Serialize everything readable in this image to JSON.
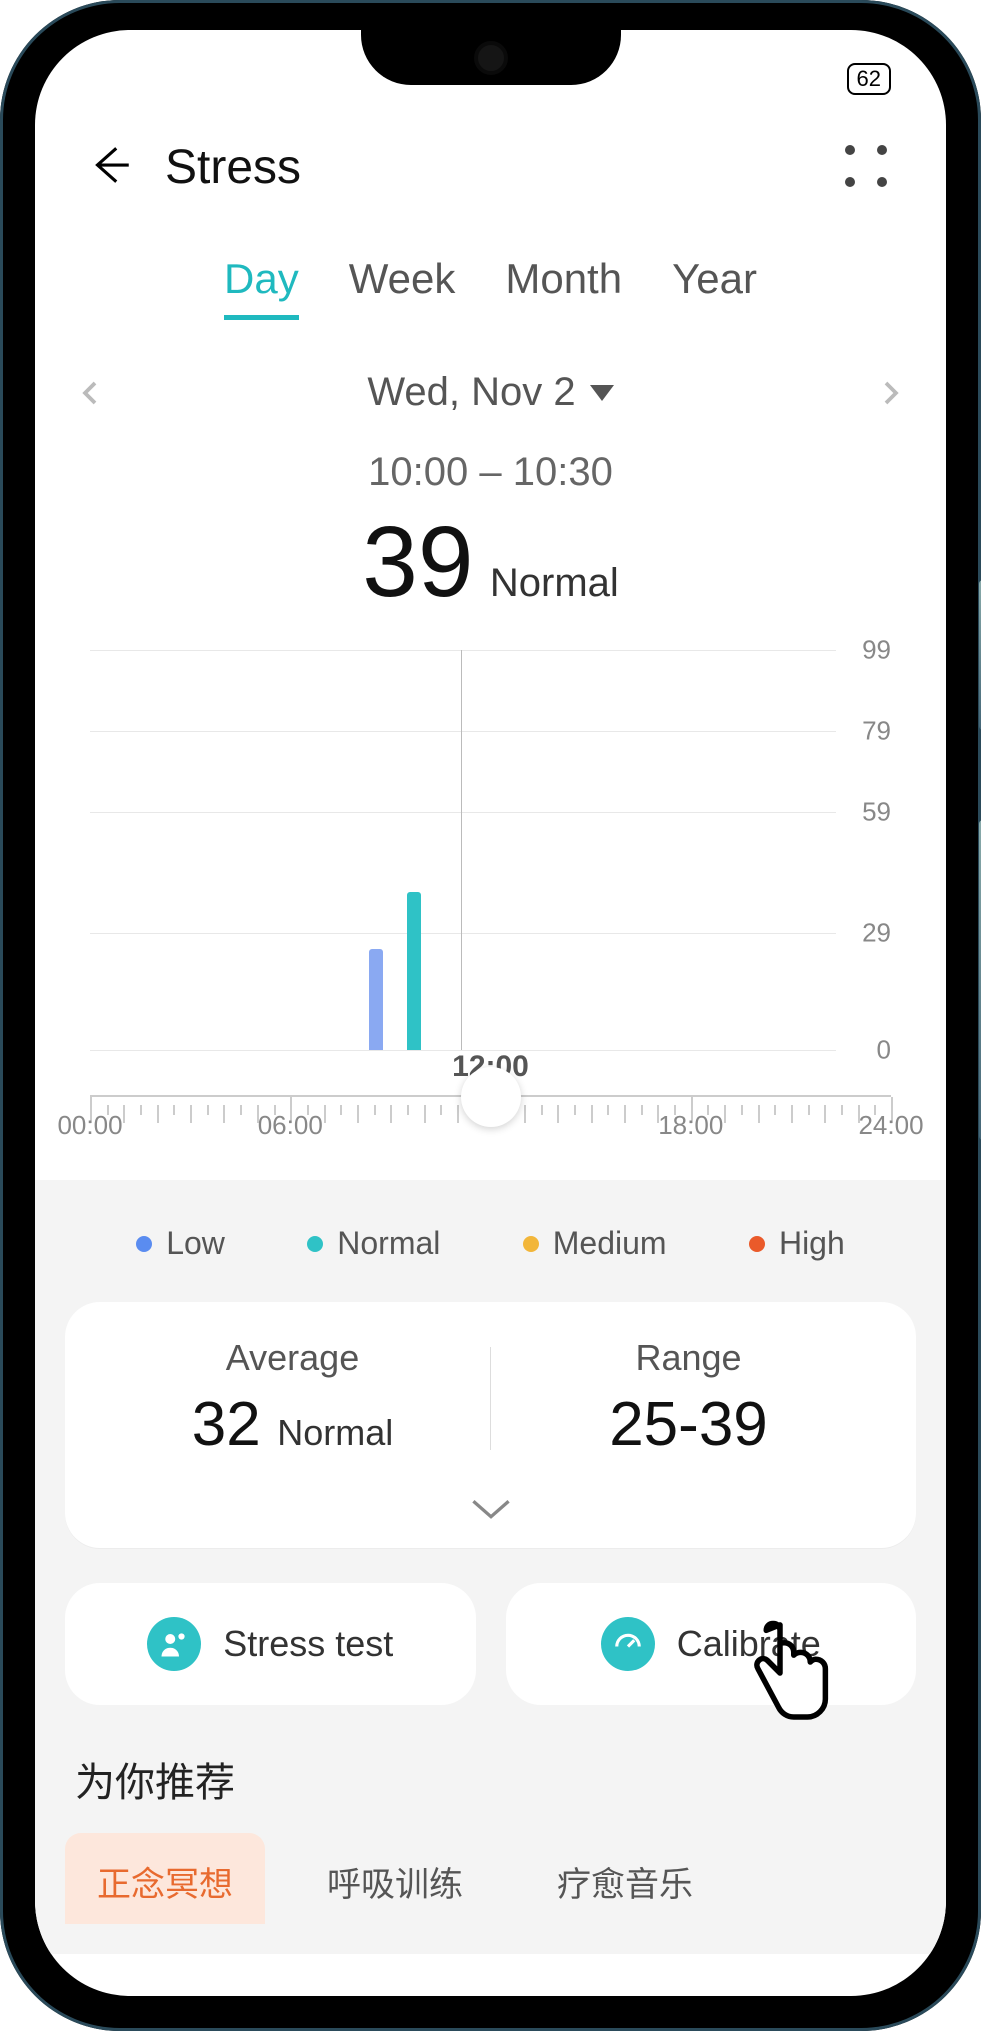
{
  "status": {
    "battery": "62"
  },
  "header": {
    "title": "Stress"
  },
  "tabs": {
    "day": "Day",
    "week": "Week",
    "month": "Month",
    "year": "Year",
    "active": "day"
  },
  "date": {
    "label": "Wed, Nov 2"
  },
  "reading": {
    "time_window": "10:00 – 10:30",
    "value": "39",
    "level": "Normal"
  },
  "chart_data": {
    "type": "bar",
    "y_axis": {
      "ticks": [
        0,
        29,
        59,
        79,
        99
      ],
      "range": [
        0,
        99
      ]
    },
    "x_axis": {
      "range_hours": [
        0,
        24
      ],
      "major_labels": [
        "00:00",
        "06:00",
        "12:00",
        "18:00",
        "24:00"
      ],
      "cursor_at": 12
    },
    "bars": [
      {
        "hour": 10.0,
        "value": 25,
        "category": "Low",
        "color": "#8aa9f2"
      },
      {
        "hour": 10.5,
        "value": 39,
        "category": "Normal",
        "color": "#2fc2c6"
      }
    ],
    "legend": [
      {
        "label": "Low",
        "color": "#5a8cf0"
      },
      {
        "label": "Normal",
        "color": "#2fc2c6"
      },
      {
        "label": "Medium",
        "color": "#f2b63a"
      },
      {
        "label": "High",
        "color": "#ea5a2a"
      }
    ]
  },
  "timeline_center_label": "12:00",
  "stats": {
    "average": {
      "title": "Average",
      "value": "32",
      "level": "Normal"
    },
    "range": {
      "title": "Range",
      "value": "25-39"
    }
  },
  "actions": {
    "stress_test": "Stress test",
    "calibrate": "Calibrate"
  },
  "recommend": {
    "title": "为你推荐",
    "chips": {
      "c1": "正念冥想",
      "c2": "呼吸训练",
      "c3": "疗愈音乐"
    }
  }
}
